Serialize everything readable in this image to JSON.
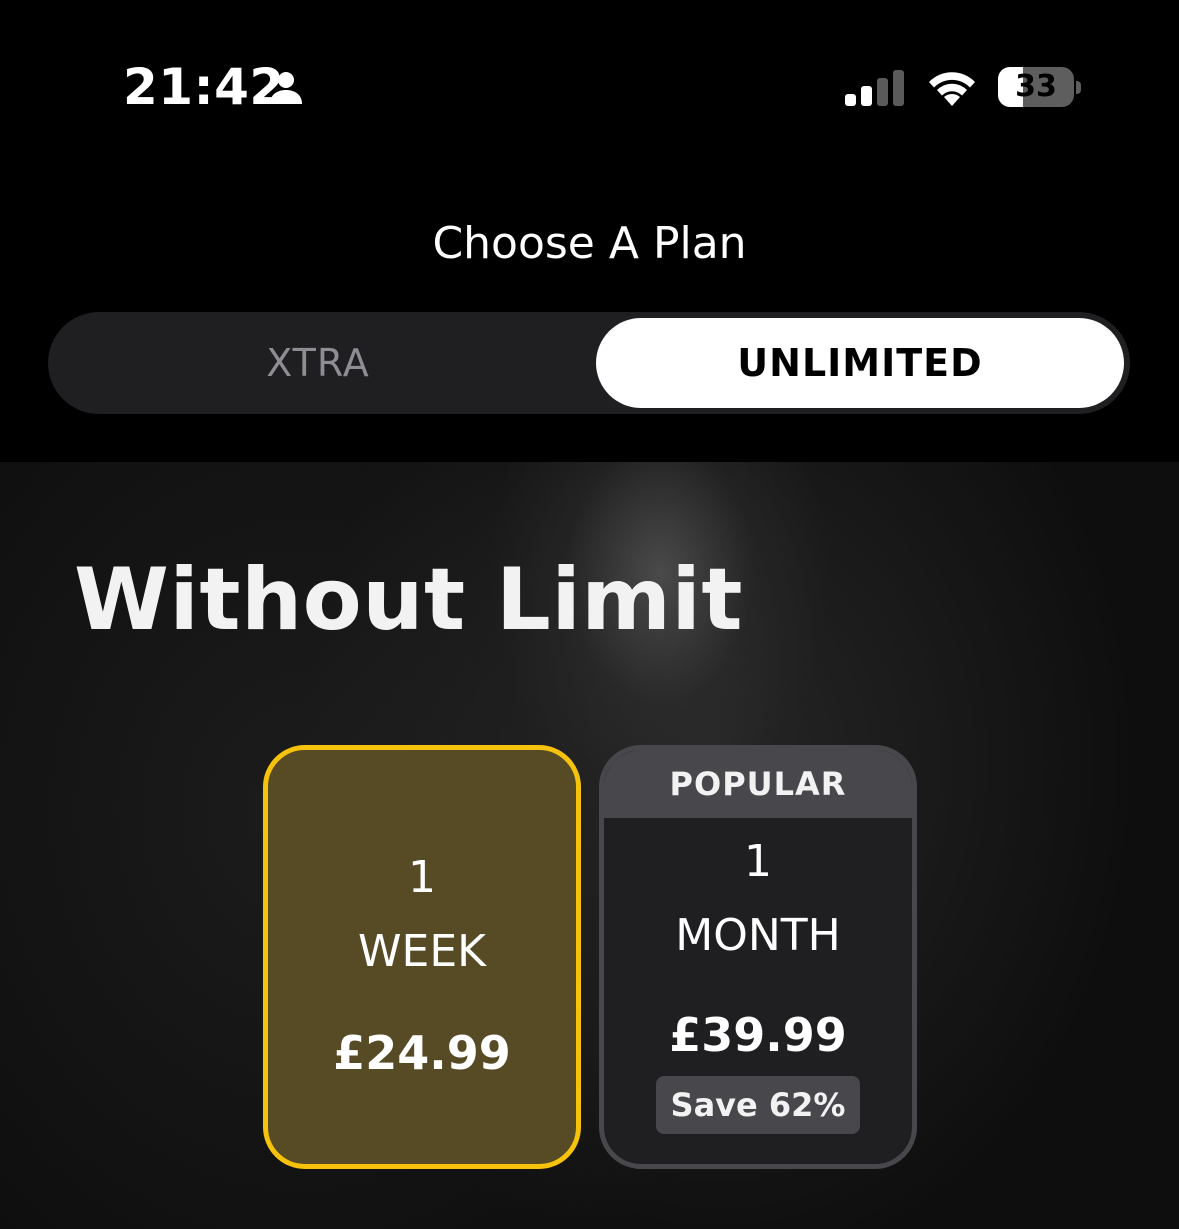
{
  "status_bar": {
    "time": "21:42",
    "battery_level": "33",
    "battery_fraction": 0.33,
    "icons": [
      "person-icon",
      "cellular-signal-icon",
      "wifi-icon",
      "battery-icon"
    ]
  },
  "header": {
    "title": "Choose A Plan",
    "tabs": [
      {
        "label": "XTRA",
        "selected": false
      },
      {
        "label": "UNLIMITED",
        "selected": true
      }
    ]
  },
  "hero": {
    "title": "Without Limit"
  },
  "plans": [
    {
      "qty": "1",
      "unit": "WEEK",
      "price": "£24.99",
      "selected": true
    },
    {
      "banner": "POPULAR",
      "qty": "1",
      "unit": "MONTH",
      "price": "£39.99",
      "save": "Save 62%",
      "selected": false
    }
  ],
  "colors": {
    "background": "#000000",
    "selected_plan_border": "#f6c20c",
    "selected_plan_fill": "#564b24",
    "card_fill": "#1f1f21",
    "card_border": "#48484c",
    "segment_selected": "#ffffff",
    "segment_unselected_text": "#8d8d93"
  }
}
